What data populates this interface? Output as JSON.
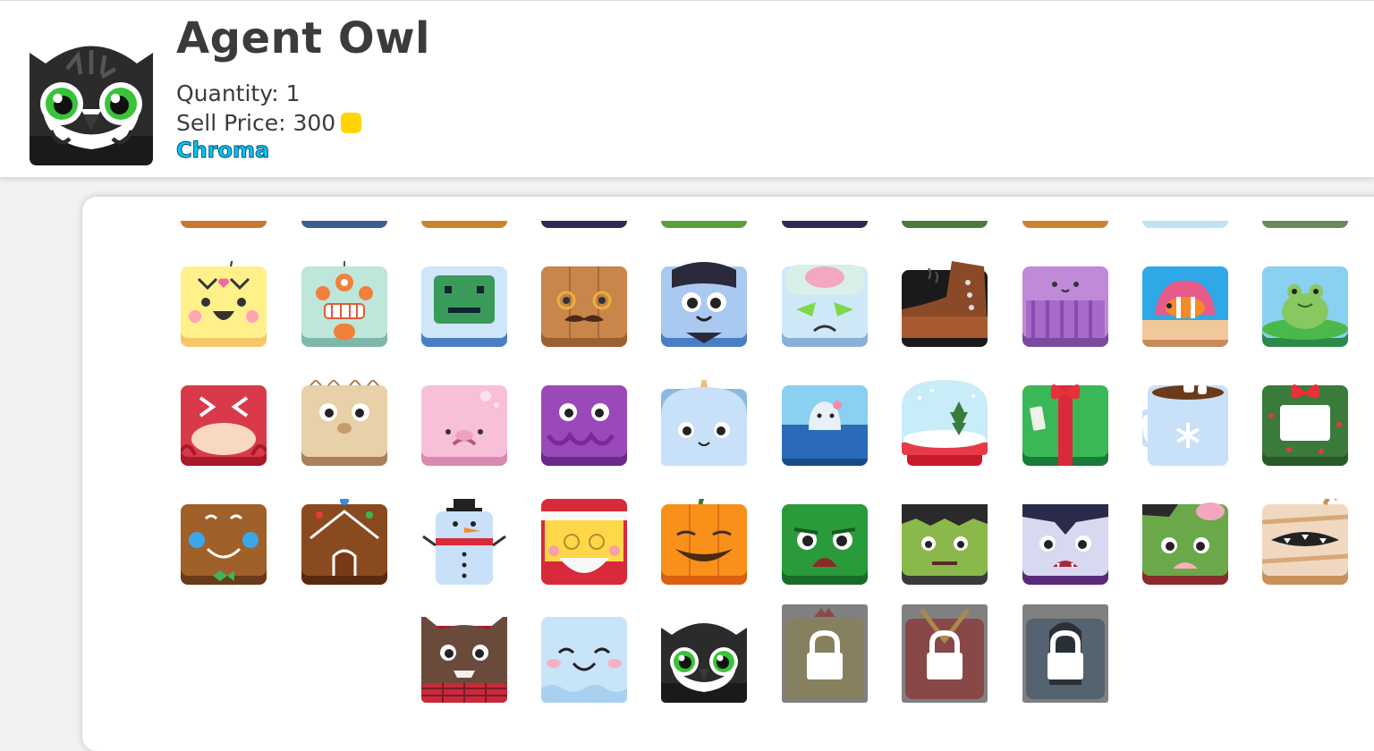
{
  "item": {
    "name": "Agent Owl",
    "quantity_label": "Quantity: 1",
    "sell_price_label": "Sell Price: 300",
    "rarity": "Chroma",
    "rarity_color": "#00c8f8",
    "coin_icon": "gold-coin-icon"
  },
  "colors": {
    "page_bg": "#f2f2f2",
    "panel_bg": "#ffffff",
    "coin": "#ffd400",
    "locked_overlay": "#808080"
  },
  "peek_row": [
    "#c9772e",
    "#3a5f8f",
    "#c9852e",
    "#2b2b55",
    "#5aa03a",
    "#2b2b55",
    "#4b7a3a",
    "#c9852e",
    "#bfe3f0",
    "#6a8a5a"
  ],
  "blooks": [
    [
      "Lovely Bot",
      "Angry Bot",
      "Happy Bot",
      "Watson",
      "Buddy Bot",
      "Brainy Bot",
      "Boot",
      "Jellyfish",
      "Clownfish",
      "Frog"
    ],
    [
      "Crab",
      "Pufferfish",
      "Blobfish",
      "Octopus",
      "Narwhal",
      "Baby Shark",
      "Snow Globe",
      "Holiday Gift",
      "Hot Chocolate",
      "Holiday Wreath"
    ],
    [
      "Gingerbread Man",
      "Gingerbread House",
      "Snowman",
      "Santa Claus",
      "Pumpkin",
      "Swamp Monster",
      "Frankenstein",
      "Vampire",
      "Zombie",
      "Mummy"
    ],
    [
      "Werewolf",
      "Ghost",
      "Agent Owl",
      "Locked 1",
      "Locked 2",
      "Locked 3"
    ]
  ]
}
